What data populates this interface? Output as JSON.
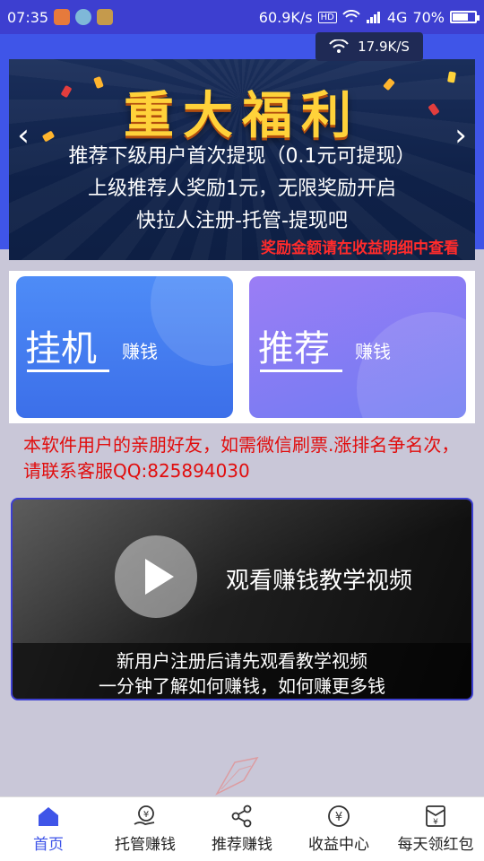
{
  "status_bar": {
    "time": "07:35",
    "net_speed": "60.9K/s",
    "hd_label": "HD",
    "network": "4G",
    "battery": "70%",
    "battery_level": 0.7
  },
  "speed_chip": {
    "value": "17.9K/S"
  },
  "banner": {
    "title": "重大福利",
    "line1": "推荐下级用户首次提现（0.1元可提现）",
    "line2": "上级推荐人奖励1元，无限奖励开启",
    "line3": "快拉人注册-托管-提现吧",
    "note": "奖励金额请在收益明细中查看"
  },
  "cards": [
    {
      "big": "挂机",
      "small": "赚钱"
    },
    {
      "big": "推荐",
      "small": "赚钱"
    }
  ],
  "notice": "本软件用户的亲朋好友，如需微信刷票.涨排名争名次，请联系客服QQ:825894030",
  "video": {
    "title": "观看赚钱教学视频",
    "caption_line1": "新用户注册后请先观看教学视频",
    "caption_line2": "一分钟了解如何赚钱，如何赚更多钱"
  },
  "tabs": [
    {
      "label": "首页",
      "icon": "home-icon",
      "active": true
    },
    {
      "label": "托管赚钱",
      "icon": "yen-hand-icon",
      "active": false
    },
    {
      "label": "推荐赚钱",
      "icon": "share-icon",
      "active": false
    },
    {
      "label": "收益中心",
      "icon": "yen-circle-icon",
      "active": false
    },
    {
      "label": "每天领红包",
      "icon": "red-envelope-icon",
      "active": false
    }
  ],
  "colors": {
    "primary": "#3f55e8",
    "notice_red": "#e10d0d",
    "banner_gold": "#ffd23a"
  }
}
